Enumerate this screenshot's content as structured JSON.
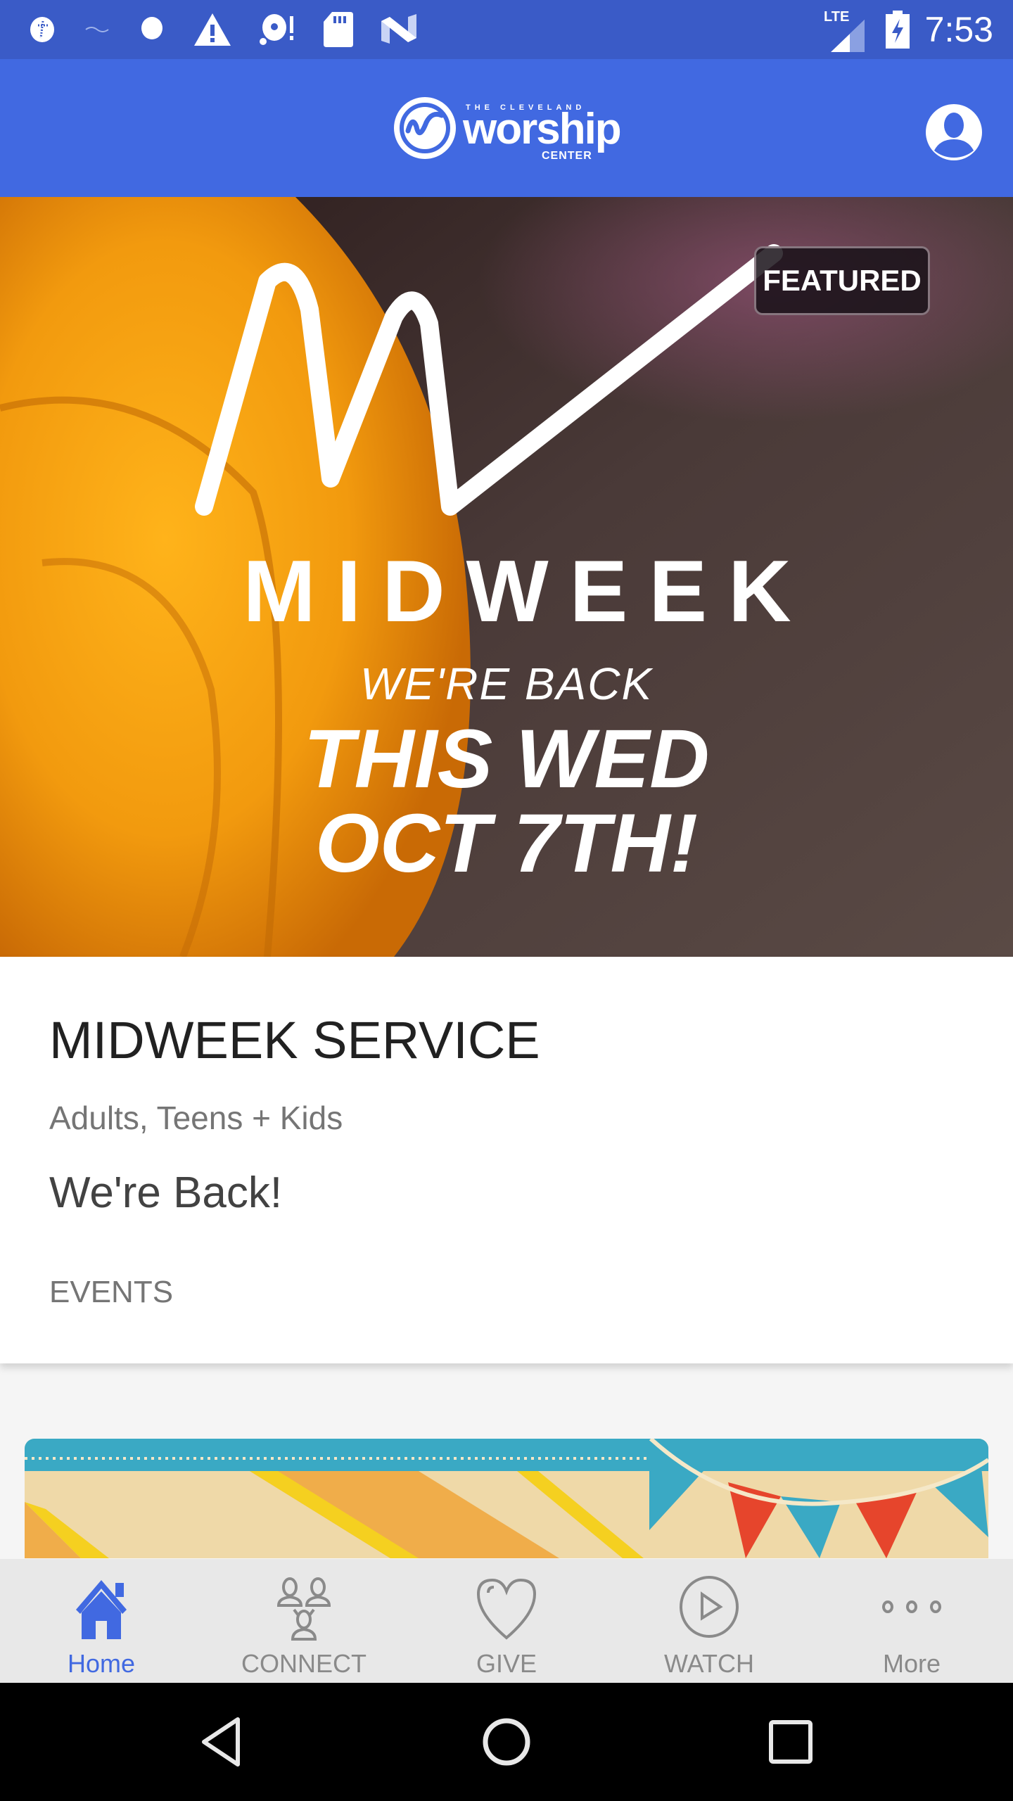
{
  "status_bar": {
    "time": "7:53",
    "network": "LTE",
    "icons": [
      "app-notification-icon",
      "app-notification-icon",
      "circle-notification-icon",
      "warning-icon",
      "disc-alert-icon",
      "sd-card-icon",
      "n-app-icon"
    ],
    "right_icons": [
      "lte-signal-icon",
      "battery-charging-icon"
    ]
  },
  "app_bar": {
    "logo_small": "THE CLEVELAND",
    "logo_main": "worship",
    "logo_sub": "CENTER",
    "profile_icon": "account-circle-icon"
  },
  "hero": {
    "badge": "FEATURED",
    "script_logo": "MW",
    "headline": "MIDWEEK",
    "line1": "WE'RE BACK",
    "line2": "THIS WED",
    "line3": "OCT 7TH!"
  },
  "card": {
    "title": "MIDWEEK SERVICE",
    "subtitle": "Adults, Teens + Kids",
    "description": "We're Back!",
    "category": "EVENTS"
  },
  "bottom_nav": {
    "items": [
      {
        "label": "Home",
        "icon": "home-icon",
        "active": true
      },
      {
        "label": "CONNECT",
        "icon": "people-network-icon",
        "active": false
      },
      {
        "label": "GIVE",
        "icon": "heart-icon",
        "active": false
      },
      {
        "label": "WATCH",
        "icon": "play-circle-icon",
        "active": false
      },
      {
        "label": "More",
        "icon": "more-dots-icon",
        "active": false
      }
    ]
  },
  "system_nav": [
    "back-icon",
    "home-circle-icon",
    "recents-icon"
  ],
  "colors": {
    "status_bar": "#3a5bc7",
    "app_bar": "#4169e1",
    "accent": "#4169e1",
    "inactive": "#8a8a8a"
  }
}
